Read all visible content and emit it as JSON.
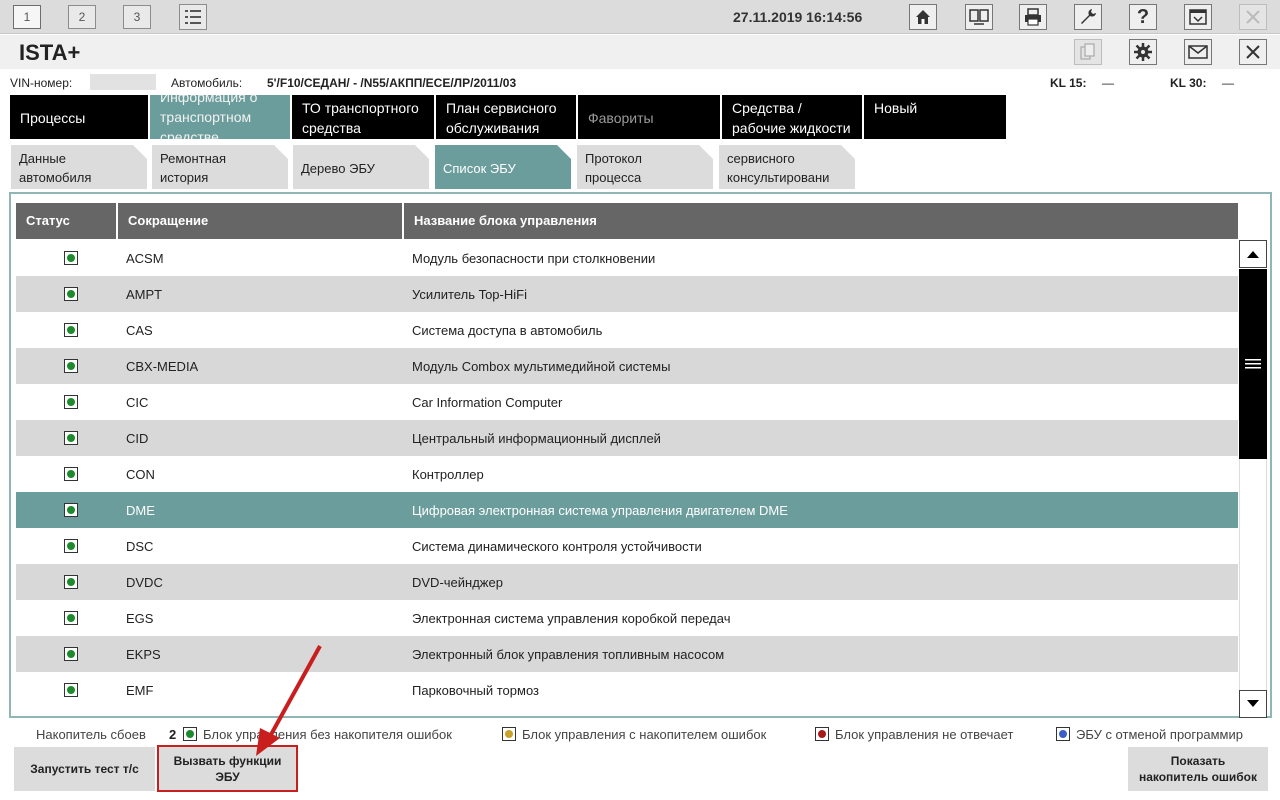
{
  "toolbar": {
    "numbers": [
      "1",
      "2",
      "3"
    ],
    "datetime": "27.11.2019 16:14:56"
  },
  "app": {
    "title": "ISTA+"
  },
  "vehicle": {
    "vin_label": "VIN-номер:",
    "car_label": "Автомобиль:",
    "car_value": "5'/F10/СЕДАН/ - /N55/АКПП/ЕСЕ/ЛР/2011/03",
    "kl15_label": "KL 15:",
    "kl15_value": "—",
    "kl30_label": "KL 30:",
    "kl30_value": "—"
  },
  "main_tabs": [
    {
      "line1": "Процессы",
      "line2": ""
    },
    {
      "line1": "Информация о",
      "line2": "транспортном",
      "line3": "средстве"
    },
    {
      "line1": "ТО транспортного",
      "line2": "средства"
    },
    {
      "line1": "План сервисного",
      "line2": "обслуживания"
    },
    {
      "line1": "Фавориты",
      "line2": ""
    },
    {
      "line1": "Средства /",
      "line2": "рабочие жидкости"
    },
    {
      "line1": "Новый",
      "line2": ""
    }
  ],
  "sub_tabs": [
    {
      "line1": "Данные",
      "line2": "автомобиля"
    },
    {
      "line1": "Ремонтная",
      "line2": "история"
    },
    {
      "line1": "Дерево ЭБУ",
      "line2": ""
    },
    {
      "line1": "Список ЭБУ",
      "line2": ""
    },
    {
      "line1": "Протокол",
      "line2": "процесса"
    },
    {
      "line1": "сервисного",
      "line2": "консультировани"
    }
  ],
  "table": {
    "headers": [
      "Статус",
      "Сокращение",
      "Название блока управления"
    ],
    "rows": [
      {
        "abbr": "ACSM",
        "name": "Модуль безопасности при столкновении"
      },
      {
        "abbr": "AMPT",
        "name": "Усилитель Top-HiFi"
      },
      {
        "abbr": "CAS",
        "name": "Система доступа в автомобиль"
      },
      {
        "abbr": "CBX-MEDIA",
        "name": "Модуль Combox мультимедийной системы"
      },
      {
        "abbr": "CIC",
        "name": "Car Information Computer"
      },
      {
        "abbr": "CID",
        "name": "Центральный информационный дисплей"
      },
      {
        "abbr": "CON",
        "name": "Контроллер"
      },
      {
        "abbr": "DME",
        "name": "Цифровая электронная система управления двигателем DME"
      },
      {
        "abbr": "DSC",
        "name": "Система динамического контроля устойчивости"
      },
      {
        "abbr": "DVDC",
        "name": "DVD-чейнджер"
      },
      {
        "abbr": "EGS",
        "name": "Электронная система управления коробкой передач"
      },
      {
        "abbr": "EKPS",
        "name": "Электронный блок управления топливным насосом"
      },
      {
        "abbr": "EMF",
        "name": "Парковочный тормоз"
      }
    ],
    "selected_index": 7
  },
  "legend": {
    "counter_label": "Накопитель сбоев",
    "counter_value": "2",
    "items": [
      {
        "label": "Блок управления без накопителя ошибок",
        "color": "#1e8a2e"
      },
      {
        "label": "Блок управления с накопителем ошибок",
        "color": "#c9a227"
      },
      {
        "label": "Блок управления не отвечает",
        "color": "#a61c1c"
      },
      {
        "label": "ЭБУ с отменой программир",
        "color": "#3b5fc8"
      }
    ]
  },
  "buttons": {
    "run_test": "Запустить тест т/с",
    "call_functions_1": "Вызвать функции",
    "call_functions_2": "ЭБУ",
    "show_memory_1": "Показать",
    "show_memory_2": "накопитель ошибок"
  },
  "colors": {
    "accent": "#6b9d9c",
    "highlight": "#c81e1e"
  }
}
